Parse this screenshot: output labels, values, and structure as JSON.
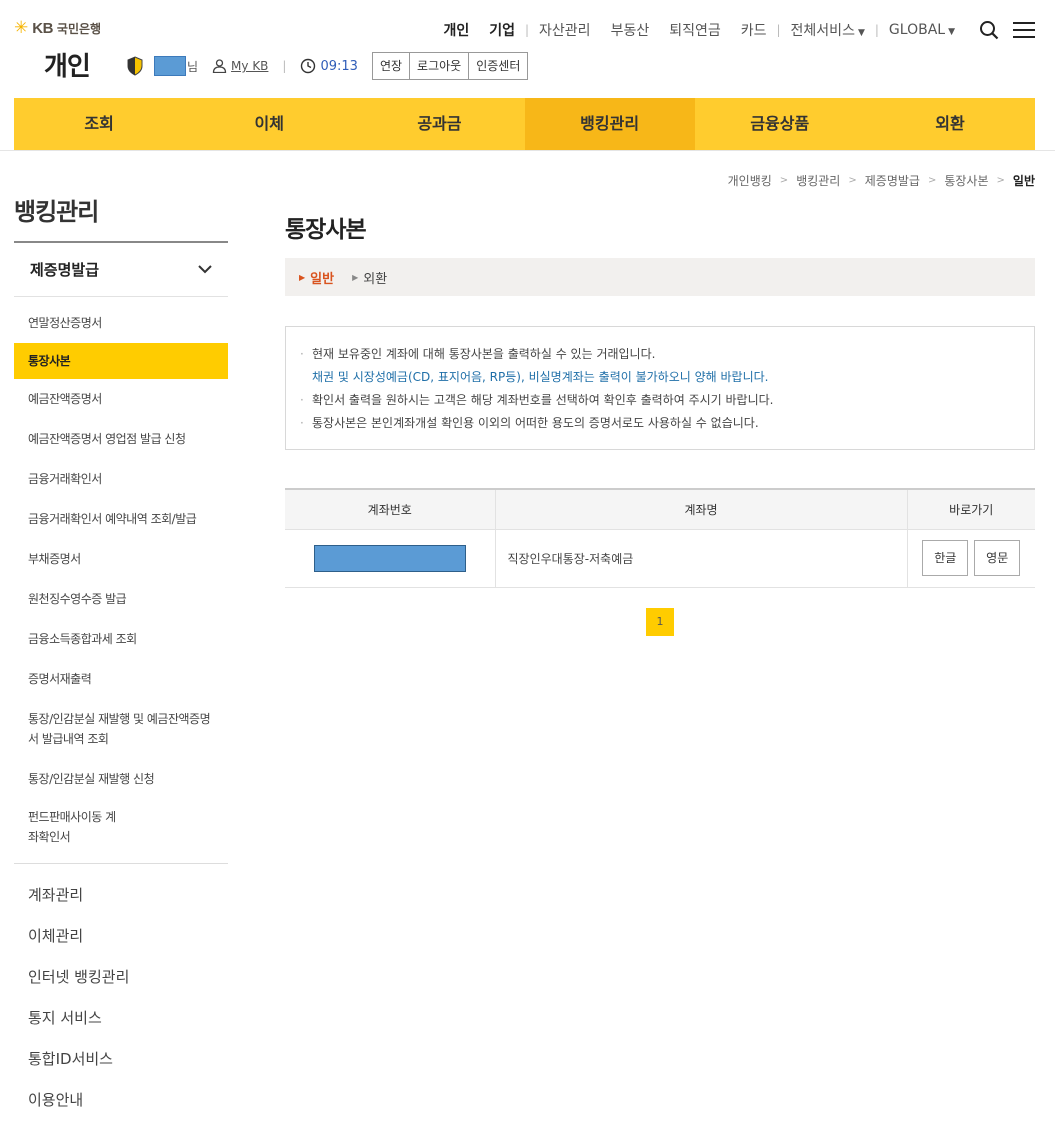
{
  "brand": {
    "logo_text": "KB",
    "bank_name": "국민은행",
    "section": "개인"
  },
  "user": {
    "suffix": "님",
    "mykb": "My KB",
    "time": "09:13",
    "buttons": [
      "연장",
      "로그아웃",
      "인증센터"
    ]
  },
  "topnav": {
    "personal": "개인",
    "corporate": "기업",
    "asset": "자산관리",
    "realestate": "부동산",
    "pension": "퇴직연금",
    "card": "카드",
    "allservices": "전체서비스",
    "global": "GLOBAL"
  },
  "gnb": [
    "조회",
    "이체",
    "공과금",
    "뱅킹관리",
    "금융상품",
    "외환"
  ],
  "breadcrumb": [
    "개인뱅킹",
    "뱅킹관리",
    "제증명발급",
    "통장사본",
    "일반"
  ],
  "lnb": {
    "title": "뱅킹관리",
    "section": "제증명발급",
    "sub_items": [
      "연말정산증명서",
      "통장사본",
      "예금잔액증명서",
      "예금잔액증명서 영업점 발급 신청",
      "금융거래확인서",
      "금융거래확인서 예약내역 조회/발급",
      "부채증명서",
      "원천징수영수증 발급",
      "금융소득종합과세 조회",
      "증명서재출력",
      "통장/인감분실 재발행 및 예금잔액증명서 발급내역 조회",
      "통장/인감분실 재발행 신청",
      "펀드판매사이동 계좌확인서"
    ],
    "main_items": [
      "계좌관리",
      "이체관리",
      "인터넷 뱅킹관리",
      "통지 서비스",
      "통합ID서비스",
      "이용안내"
    ]
  },
  "content": {
    "title": "통장사본",
    "tabs": [
      "일반",
      "외환"
    ],
    "notice": [
      "현재 보유중인 계좌에 대해 통장사본을 출력하실 수 있는 거래입니다.",
      "채권 및 시장성예금(CD, 표지어음, RP등), 비실명계좌는 출력이 불가하오니 양해 바랍니다.",
      "확인서 출력을 원하시는 고객은 해당 계좌번호를 선택하여 확인후 출력하여 주시기 바랍니다.",
      "통장사본은 본인계좌개설 확인용 이외의 어떠한 용도의 증명서로도 사용하실 수 없습니다."
    ],
    "table": {
      "headers": [
        "계좌번호",
        "계좌명",
        "바로가기"
      ],
      "rows": [
        {
          "account_name": "직장인우대통장-저축예금",
          "btn_korean": "한글",
          "btn_english": "영문"
        }
      ]
    },
    "page": "1"
  }
}
